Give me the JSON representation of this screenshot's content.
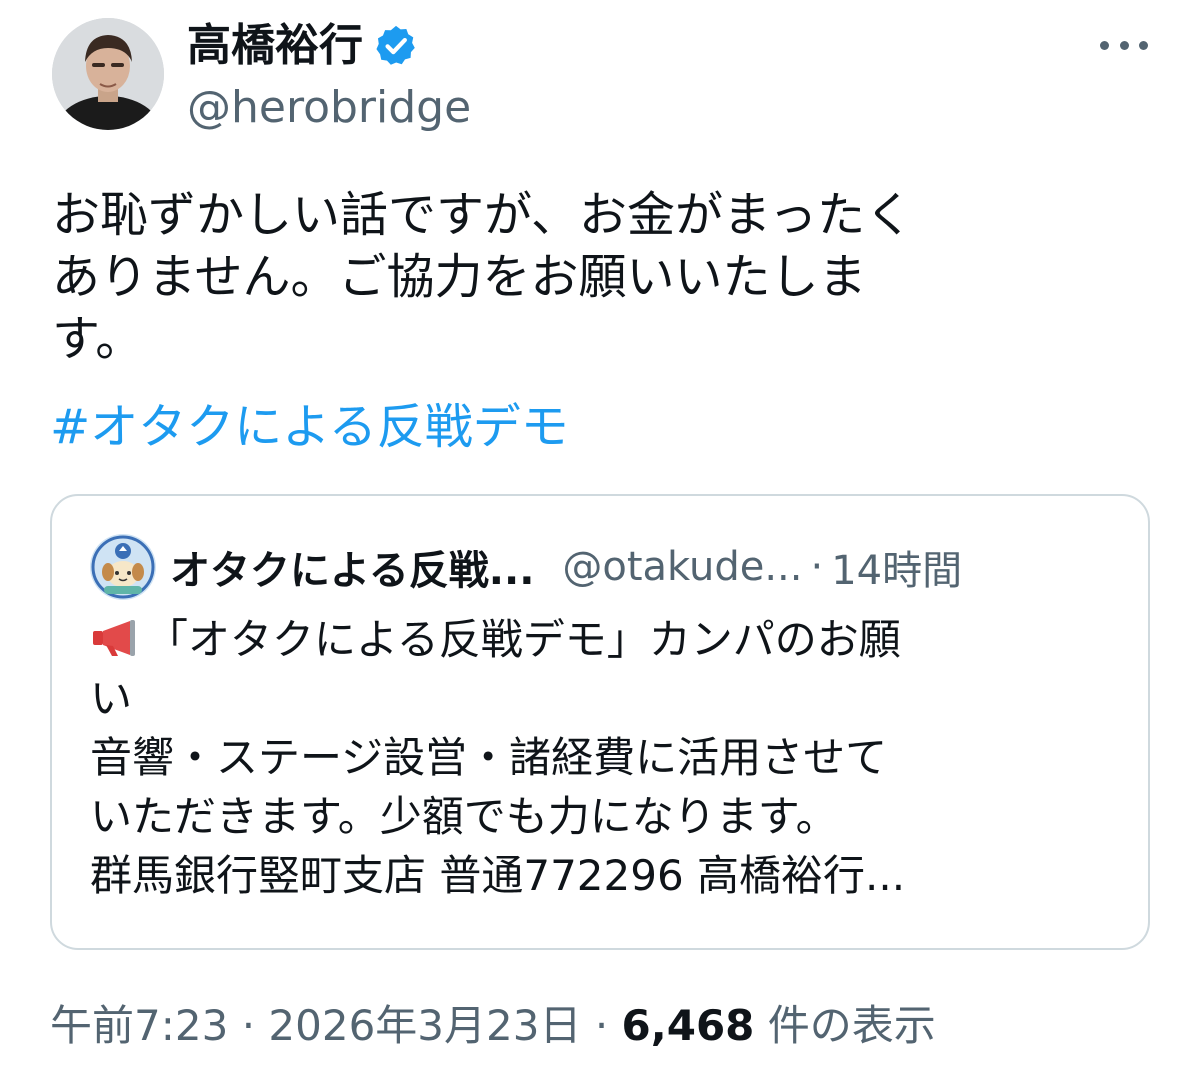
{
  "author": {
    "name": "高橋裕行",
    "handle": "@herobridge",
    "verified_icon": "verified-badge-icon",
    "avatar": "profile-photo"
  },
  "more_icon": "more-options-icon",
  "tweet": {
    "lines": [
      "お恥ずかしい話ですが、お金がまったく",
      "ありません。ご協力をお願いいたしま",
      "す。"
    ],
    "hashtag": "#オタクによる反戦デモ"
  },
  "quote": {
    "name": "オタクによる反戦...",
    "handle": "@otakude...",
    "separator": "·",
    "time": "14時間",
    "icon": "megaphone-icon",
    "lines": [
      "「オタクによる反戦デモ」カンパのお願",
      "い",
      "音響・ステージ設営・諸経費に活用させて",
      "いただきます。少額でも力になります。",
      "群馬銀行竪町支店 普通772296 高橋裕行..."
    ]
  },
  "meta": {
    "time": "午前7:23",
    "sep1": "·",
    "date": "2026年3月23日",
    "sep2": "·",
    "views_count": "6,468",
    "views_label": "件の表示"
  },
  "colors": {
    "link": "#1d9bf0",
    "secondary": "#536471",
    "border": "#cfd9de",
    "verified": "#1d9bf0"
  }
}
